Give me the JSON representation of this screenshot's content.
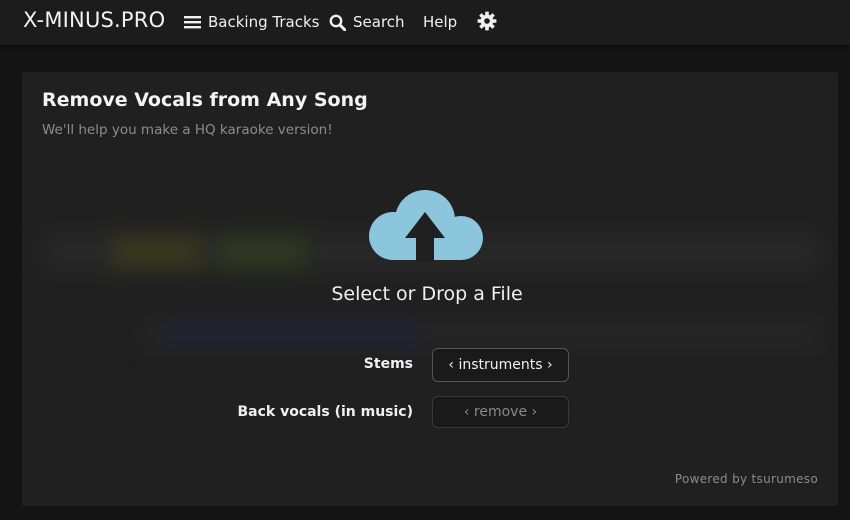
{
  "header": {
    "logo": "X-MINUS.PRO",
    "nav": {
      "backing_tracks": {
        "label": "Backing Tracks",
        "icon": "menu-icon"
      },
      "search": {
        "label": "Search",
        "icon": "search-icon"
      },
      "help": {
        "label": "Help"
      },
      "settings": {
        "icon": "gear-icon"
      }
    }
  },
  "main": {
    "title": "Remove Vocals from Any Song",
    "subtitle": "We'll help you make a HQ karaoke version!",
    "upload": {
      "label": "Select or Drop a File",
      "icon": "cloud-upload-icon",
      "icon_color": "#8cc6dc"
    },
    "options": {
      "stems": {
        "label": "Stems",
        "value": "‹ instruments ›"
      },
      "back_vocals": {
        "label": "Back vocals (in music)",
        "value": "‹ remove ›"
      }
    },
    "footer": "Powered by tsurumeso"
  },
  "colors": {
    "background": "#141414",
    "topbar": "#1c1c1c",
    "panel": "#202020",
    "accent": "#8cc6dc"
  }
}
